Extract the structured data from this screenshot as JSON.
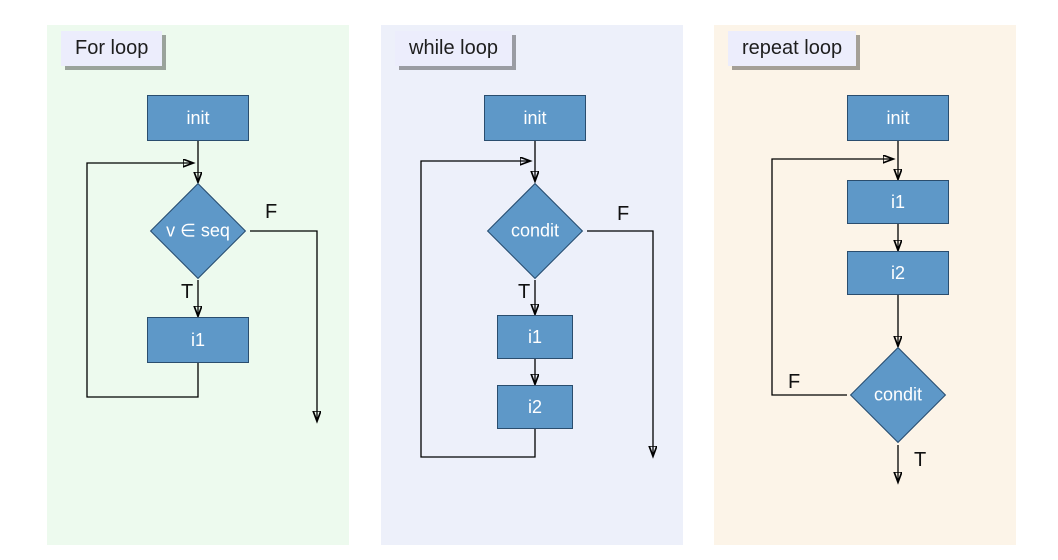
{
  "for": {
    "title": "For loop",
    "init": "init",
    "decision": "v ∈ seq",
    "i1": "i1",
    "true_label": "T",
    "false_label": "F"
  },
  "while": {
    "title": "while loop",
    "init": "init",
    "decision": "condit",
    "i1": "i1",
    "i2": "i2",
    "true_label": "T",
    "false_label": "F"
  },
  "repeat": {
    "title": "repeat loop",
    "init": "init",
    "i1": "i1",
    "i2": "i2",
    "decision": "condit",
    "true_label": "T",
    "false_label": "F"
  }
}
